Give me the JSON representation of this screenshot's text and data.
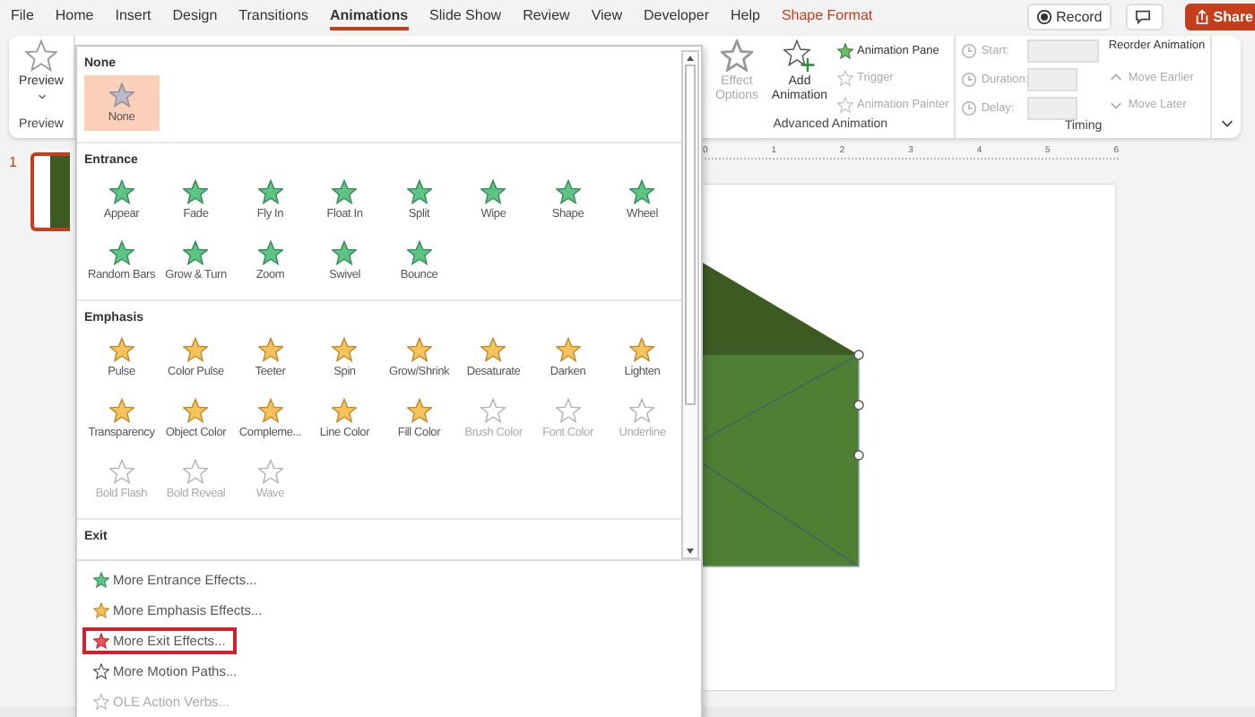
{
  "tabs": [
    {
      "label": "File",
      "selected": false,
      "kind": "normal"
    },
    {
      "label": "Home",
      "selected": false,
      "kind": "normal"
    },
    {
      "label": "Insert",
      "selected": false,
      "kind": "normal"
    },
    {
      "label": "Design",
      "selected": false,
      "kind": "normal"
    },
    {
      "label": "Transitions",
      "selected": false,
      "kind": "normal"
    },
    {
      "label": "Animations",
      "selected": true,
      "kind": "normal"
    },
    {
      "label": "Slide Show",
      "selected": false,
      "kind": "normal"
    },
    {
      "label": "Review",
      "selected": false,
      "kind": "normal"
    },
    {
      "label": "View",
      "selected": false,
      "kind": "normal"
    },
    {
      "label": "Developer",
      "selected": false,
      "kind": "normal"
    },
    {
      "label": "Help",
      "selected": false,
      "kind": "normal"
    },
    {
      "label": "Shape Format",
      "selected": false,
      "kind": "contextual"
    }
  ],
  "actions": {
    "record": "Record",
    "share": "Share"
  },
  "ribbon": {
    "preview": {
      "button": "Preview",
      "group": "Preview"
    },
    "effect_options": {
      "label": "Effect Options",
      "disabled": true
    },
    "add_animation": {
      "label": "Add Animation"
    },
    "advanced": [
      {
        "label": "Animation Pane",
        "disabled": false
      },
      {
        "label": "Trigger",
        "disabled": true
      },
      {
        "label": "Animation Painter",
        "disabled": true
      }
    ],
    "advanced_group": "Advanced Animation",
    "timing": [
      {
        "label": "Start:",
        "disabled": true
      },
      {
        "label": "Duration:",
        "disabled": true
      },
      {
        "label": "Delay:",
        "disabled": true
      }
    ],
    "reorder": {
      "title": "Reorder Animation",
      "items": [
        {
          "label": "Move Earlier",
          "disabled": true
        },
        {
          "label": "Move Later",
          "disabled": true
        }
      ]
    },
    "timing_group": "Timing"
  },
  "ruler": [
    "0",
    "1",
    "2",
    "3",
    "4",
    "5",
    "6"
  ],
  "thumbnails": [
    {
      "number": "1",
      "selected": true
    }
  ],
  "gallery": {
    "sections": [
      {
        "title": "None",
        "kind": "none",
        "items": [
          {
            "label": "None",
            "selected": true,
            "disabled": false
          }
        ]
      },
      {
        "title": "Entrance",
        "kind": "entrance",
        "items": [
          {
            "label": "Appear",
            "selected": false,
            "disabled": false
          },
          {
            "label": "Fade",
            "selected": false,
            "disabled": false
          },
          {
            "label": "Fly In",
            "selected": false,
            "disabled": false
          },
          {
            "label": "Float In",
            "selected": false,
            "disabled": false
          },
          {
            "label": "Split",
            "selected": false,
            "disabled": false
          },
          {
            "label": "Wipe",
            "selected": false,
            "disabled": false
          },
          {
            "label": "Shape",
            "selected": false,
            "disabled": false
          },
          {
            "label": "Wheel",
            "selected": false,
            "disabled": false
          },
          {
            "label": "Random Bars",
            "selected": false,
            "disabled": false
          },
          {
            "label": "Grow & Turn",
            "selected": false,
            "disabled": false
          },
          {
            "label": "Zoom",
            "selected": false,
            "disabled": false
          },
          {
            "label": "Swivel",
            "selected": false,
            "disabled": false
          },
          {
            "label": "Bounce",
            "selected": false,
            "disabled": false
          }
        ]
      },
      {
        "title": "Emphasis",
        "kind": "emphasis",
        "items": [
          {
            "label": "Pulse",
            "selected": false,
            "disabled": false
          },
          {
            "label": "Color Pulse",
            "selected": false,
            "disabled": false
          },
          {
            "label": "Teeter",
            "selected": false,
            "disabled": false
          },
          {
            "label": "Spin",
            "selected": false,
            "disabled": false
          },
          {
            "label": "Grow/Shrink",
            "selected": false,
            "disabled": false
          },
          {
            "label": "Desaturate",
            "selected": false,
            "disabled": false
          },
          {
            "label": "Darken",
            "selected": false,
            "disabled": false
          },
          {
            "label": "Lighten",
            "selected": false,
            "disabled": false
          },
          {
            "label": "Transparency",
            "selected": false,
            "disabled": false
          },
          {
            "label": "Object Color",
            "selected": false,
            "disabled": false
          },
          {
            "label": "Compleme...",
            "selected": false,
            "disabled": false
          },
          {
            "label": "Line Color",
            "selected": false,
            "disabled": false
          },
          {
            "label": "Fill Color",
            "selected": false,
            "disabled": false
          },
          {
            "label": "Brush Color",
            "selected": false,
            "disabled": true
          },
          {
            "label": "Font Color",
            "selected": false,
            "disabled": true
          },
          {
            "label": "Underline",
            "selected": false,
            "disabled": true
          },
          {
            "label": "Bold Flash",
            "selected": false,
            "disabled": true
          },
          {
            "label": "Bold Reveal",
            "selected": false,
            "disabled": true
          },
          {
            "label": "Wave",
            "selected": false,
            "disabled": true
          }
        ]
      },
      {
        "title": "Exit"
      }
    ],
    "commands": [
      {
        "label": "More Entrance Effects...",
        "kind": "entrance",
        "disabled": false,
        "highlighted": false
      },
      {
        "label": "More Emphasis Effects...",
        "kind": "emphasis",
        "disabled": false,
        "highlighted": false
      },
      {
        "label": "More Exit Effects...",
        "kind": "exit",
        "disabled": false,
        "highlighted": true
      },
      {
        "label": "More Motion Paths...",
        "kind": "motion",
        "disabled": false,
        "highlighted": false
      },
      {
        "label": "OLE Action Verbs...",
        "kind": "ole",
        "disabled": true,
        "highlighted": false
      }
    ]
  }
}
